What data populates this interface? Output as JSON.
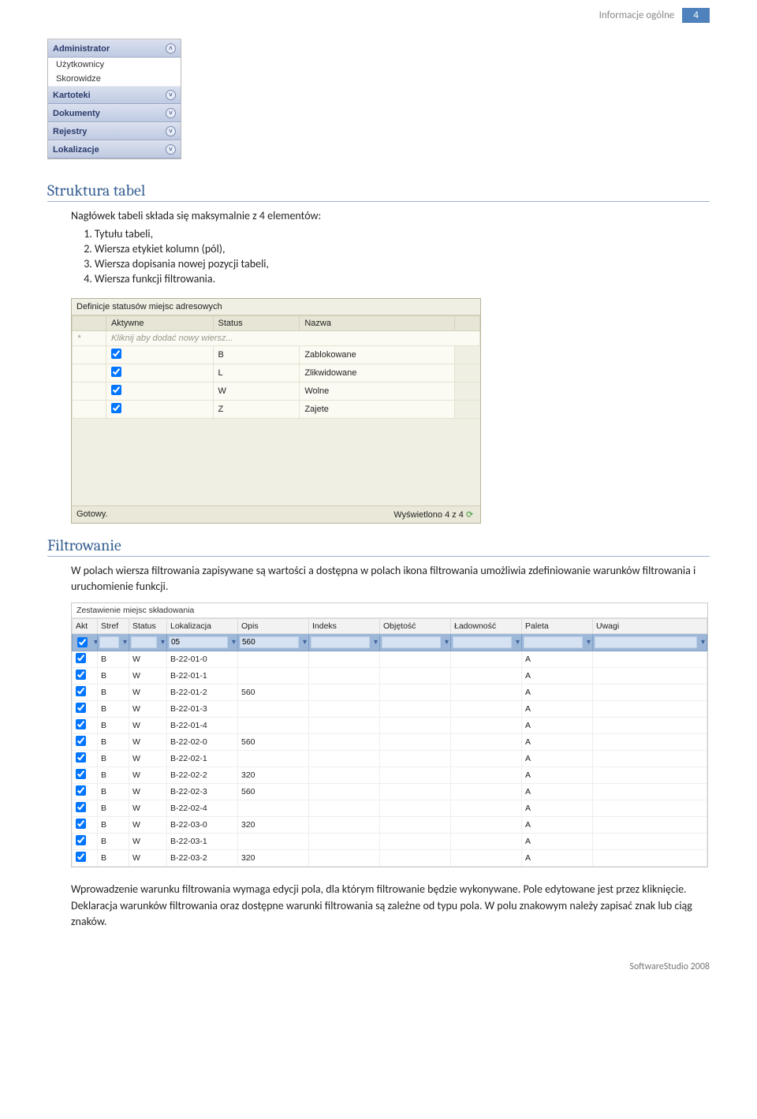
{
  "header": {
    "running": "Informacje ogólne",
    "page": "4"
  },
  "nav": {
    "groups": [
      {
        "label": "Administrator",
        "expanded": true,
        "items": [
          "Użytkownicy",
          "Skorowidze"
        ]
      },
      {
        "label": "Kartoteki",
        "expanded": false,
        "items": []
      },
      {
        "label": "Dokumenty",
        "expanded": false,
        "items": []
      },
      {
        "label": "Rejestry",
        "expanded": false,
        "items": []
      },
      {
        "label": "Lokalizacje",
        "expanded": false,
        "items": []
      }
    ]
  },
  "section_struct": {
    "title": "Struktura tabel",
    "intro": "Nagłówek tabeli składa się maksymalnie z 4 elementów:",
    "items": [
      "Tytułu tabeli,",
      "Wiersza etykiet kolumn (pól),",
      "Wiersza dopisania nowej pozycji tabeli,",
      "Wiersza funkcji filtrowania."
    ]
  },
  "khaki_table": {
    "title": "Definicje statusów miejsc adresowych",
    "columns": [
      "",
      "Aktywne",
      "Status",
      "Nazwa",
      ""
    ],
    "new_row_hint": "Kliknij aby dodać nowy wiersz...",
    "rows": [
      {
        "aktywne": true,
        "status": "B",
        "nazwa": "Zablokowane"
      },
      {
        "aktywne": true,
        "status": "L",
        "nazwa": "Zlikwidowane"
      },
      {
        "aktywne": true,
        "status": "W",
        "nazwa": "Wolne"
      },
      {
        "aktywne": true,
        "status": "Z",
        "nazwa": "Zajete"
      }
    ],
    "status_left": "Gotowy.",
    "status_right": "Wyświetlono 4 z 4"
  },
  "section_filter": {
    "title": "Filtrowanie",
    "para": "W polach wiersza filtrowania zapisywane są wartości a dostępna w polach ikona filtrowania umożliwia zdefiniowanie warunków filtrowania i uruchomienie funkcji."
  },
  "grid": {
    "title": "Zestawienie miejsc składowania",
    "columns": [
      "Akt",
      "Stref",
      "Status",
      "Lokalizacja",
      "Opis",
      "Indeks",
      "Objętość",
      "Ładowność",
      "Paleta",
      "Uwagi"
    ],
    "filter": {
      "akt": "",
      "stref": "",
      "status": "",
      "lokalizacja": "05",
      "opis": "560",
      "indeks": "",
      "objetosc": "",
      "ladownosc": "",
      "paleta": "",
      "uwagi": ""
    },
    "rows": [
      {
        "akt": true,
        "stref": "B",
        "status": "W",
        "lok": "B-22-01-0",
        "opis": "",
        "paleta": "A"
      },
      {
        "akt": true,
        "stref": "B",
        "status": "W",
        "lok": "B-22-01-1",
        "opis": "",
        "paleta": "A"
      },
      {
        "akt": true,
        "stref": "B",
        "status": "W",
        "lok": "B-22-01-2",
        "opis": "560",
        "paleta": "A"
      },
      {
        "akt": true,
        "stref": "B",
        "status": "W",
        "lok": "B-22-01-3",
        "opis": "",
        "paleta": "A"
      },
      {
        "akt": true,
        "stref": "B",
        "status": "W",
        "lok": "B-22-01-4",
        "opis": "",
        "paleta": "A"
      },
      {
        "akt": true,
        "stref": "B",
        "status": "W",
        "lok": "B-22-02-0",
        "opis": "560",
        "paleta": "A"
      },
      {
        "akt": true,
        "stref": "B",
        "status": "W",
        "lok": "B-22-02-1",
        "opis": "",
        "paleta": "A"
      },
      {
        "akt": true,
        "stref": "B",
        "status": "W",
        "lok": "B-22-02-2",
        "opis": "320",
        "paleta": "A"
      },
      {
        "akt": true,
        "stref": "B",
        "status": "W",
        "lok": "B-22-02-3",
        "opis": "560",
        "paleta": "A"
      },
      {
        "akt": true,
        "stref": "B",
        "status": "W",
        "lok": "B-22-02-4",
        "opis": "",
        "paleta": "A"
      },
      {
        "akt": true,
        "stref": "B",
        "status": "W",
        "lok": "B-22-03-0",
        "opis": "320",
        "paleta": "A"
      },
      {
        "akt": true,
        "stref": "B",
        "status": "W",
        "lok": "B-22-03-1",
        "opis": "",
        "paleta": "A"
      },
      {
        "akt": true,
        "stref": "B",
        "status": "W",
        "lok": "B-22-03-2",
        "opis": "320",
        "paleta": "A"
      }
    ]
  },
  "para_after_grid": "Wprowadzenie warunku filtrowania wymaga edycji pola, dla którym filtrowanie będzie wykonywane. Pole edytowane jest przez kliknięcie. Deklaracja warunków filtrowania oraz dostępne warunki filtrowania są zależne od typu pola. W polu znakowym należy zapisać znak lub ciąg znaków.",
  "footer": "SoftwareStudio 2008"
}
